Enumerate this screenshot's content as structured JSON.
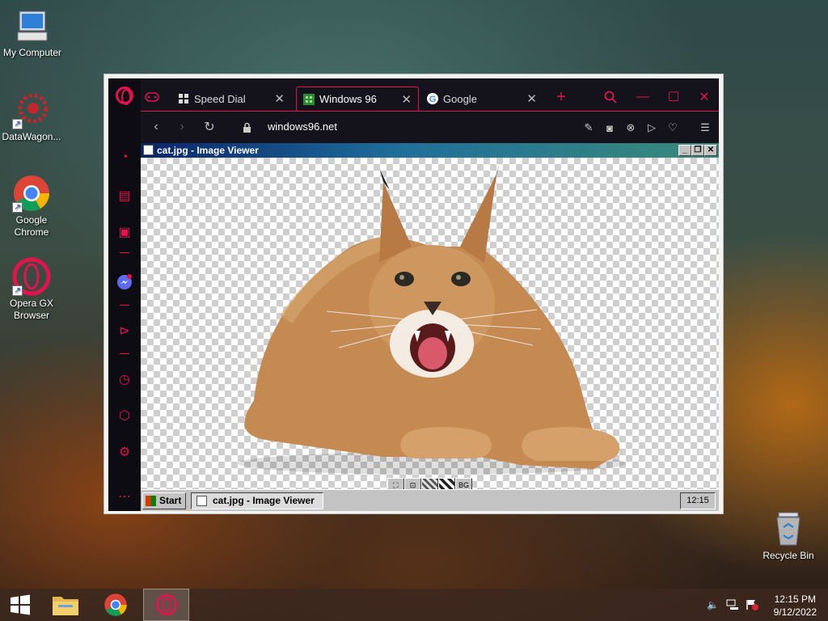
{
  "desktop": {
    "icons": [
      {
        "label": "My Computer",
        "icon": "computer-icon"
      },
      {
        "label": "DataWagon...",
        "icon": "datawagon-icon"
      },
      {
        "label": "Google Chrome",
        "icon": "chrome-icon"
      },
      {
        "label": "Opera GX Browser",
        "icon": "opera-gx-icon"
      },
      {
        "label": "Recycle Bin",
        "icon": "recycle-bin-icon"
      }
    ]
  },
  "browser": {
    "tabs": [
      {
        "label": "Speed Dial",
        "icon": "grid-icon"
      },
      {
        "label": "Windows 96",
        "icon": "windows96-icon",
        "active": true
      },
      {
        "label": "Google",
        "icon": "google-icon"
      }
    ],
    "new_tab": "+",
    "address": "windows96.net",
    "accent": "#e2134f"
  },
  "image_viewer": {
    "title": "cat.jpg - Image Viewer",
    "tools": [
      "",
      "",
      "",
      "",
      "BG"
    ]
  },
  "w96_taskbar": {
    "start": "Start",
    "task": "cat.jpg - Image Viewer",
    "clock": "12:15"
  },
  "taskbar": {
    "time": "12:15 PM",
    "date": "9/12/2022"
  }
}
